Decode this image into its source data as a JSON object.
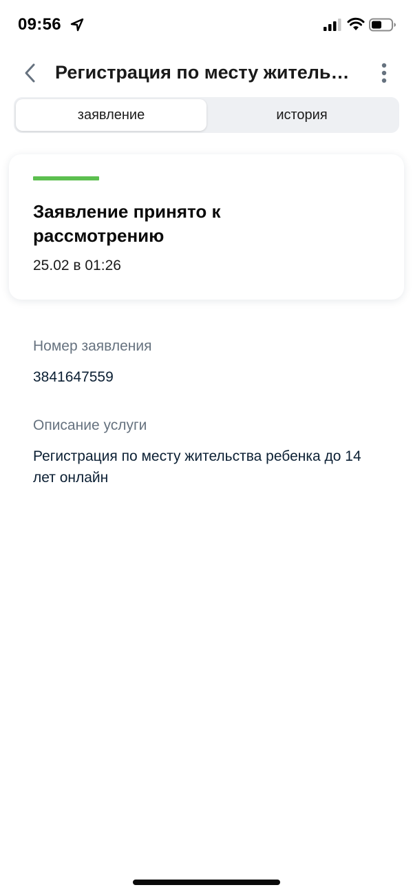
{
  "status_bar": {
    "time": "09:56"
  },
  "header": {
    "title": "Регистрация по месту жительства ребенка до 14 лет онлайн"
  },
  "tabs": [
    {
      "label": "заявление",
      "active": true
    },
    {
      "label": "история",
      "active": false
    }
  ],
  "status_card": {
    "title": "Заявление принято к рассмотрению",
    "date": "25.02 в 01:26",
    "accent_color": "#5cbf4f"
  },
  "fields": [
    {
      "label": "Номер заявления",
      "value": "3841647559"
    },
    {
      "label": "Описание услуги",
      "value": "Регистрация по месту жительства ребенка до 14 лет онлайн"
    }
  ],
  "icons": {
    "location": "location-arrow-icon",
    "signal": "cellular-signal-icon",
    "wifi": "wifi-icon",
    "battery": "battery-icon",
    "back": "chevron-left-icon",
    "more": "more-vertical-icon"
  }
}
